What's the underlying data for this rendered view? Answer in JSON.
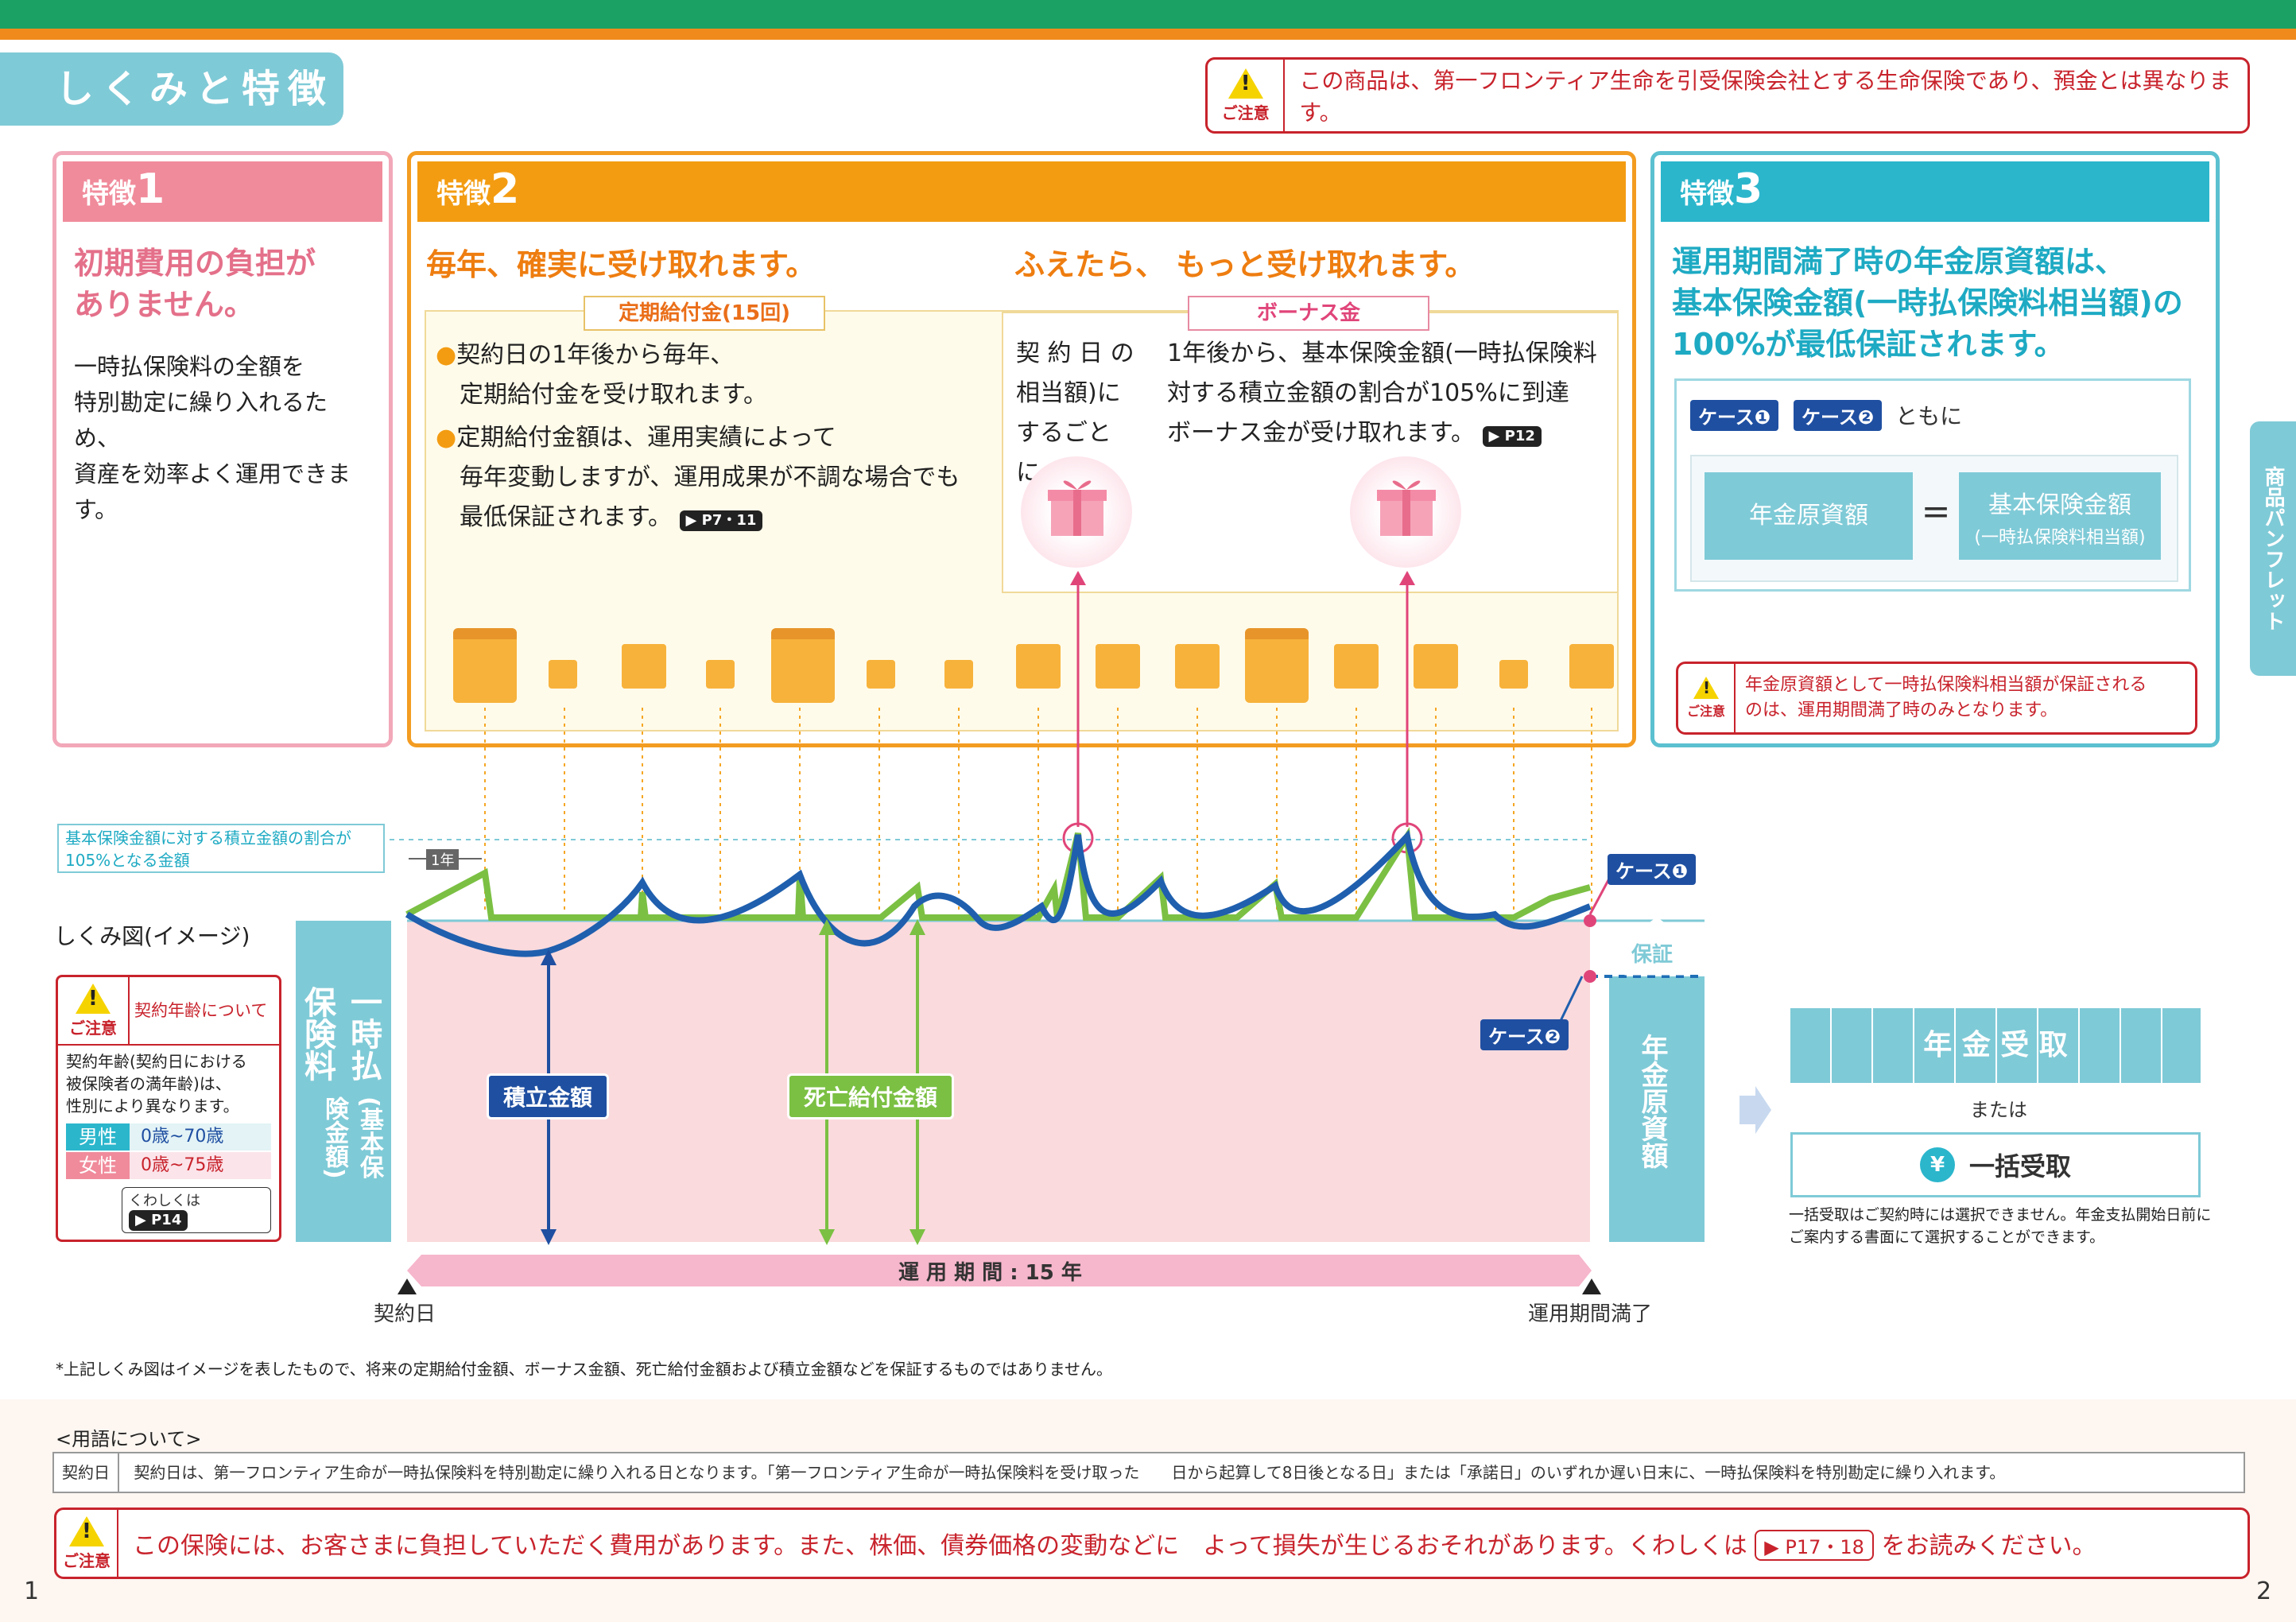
{
  "header": {
    "section_title": "しくみと特徴"
  },
  "caution_label": "ご注意",
  "top_notice": "この商品は、第一フロンティア生命を引受保険会社とする生命保険であり、預金とは異なります。",
  "side_tab": "商品パンフレット",
  "feature1": {
    "label": "特徴",
    "num": "1",
    "heading": [
      "初期費用の負担が",
      "ありません。"
    ],
    "body": [
      "一時払保険料の全額を",
      "特別勘定に繰り入れるため、",
      "資産を効率よく運用できます。"
    ]
  },
  "feature2": {
    "label": "特徴",
    "num": "2",
    "heading_left": "毎年、確実に受け取れます。",
    "heading_right": "ふえたら、 もっと受け取れます。",
    "left_tag": "定期給付金(15回)",
    "left_bullets": [
      [
        "契約日の1年後から毎年、",
        "定期給付金を受け取れます。"
      ],
      [
        "定期給付金額は、運用実績によって",
        "毎年変動しますが、運用成果が不調な場合でも",
        "最低保証されます。"
      ]
    ],
    "left_ref": "P7・11",
    "right_tag": "ボーナス金",
    "right_col1": [
      "契 約 日 の",
      "相当額)に",
      "するごとに、"
    ],
    "right_col2": [
      "1年後から、基本保険金額(一時払保険料",
      "対する積立金額の割合が105%に到達",
      "ボーナス金が受け取れます。"
    ],
    "right_ref": "P12"
  },
  "feature3": {
    "label": "特徴",
    "num": "3",
    "heading": [
      "運用期間満了時の年金原資額は、",
      "基本保険金額(一時払保険料相当額)の",
      "100%が最低保証されます。"
    ],
    "case1": "ケース❶",
    "case2": "ケース❷",
    "case_suffix": "ともに",
    "eq_left": "年金原資額",
    "eq_sign": "=",
    "eq_right_main": "基本保険金額",
    "eq_right_sub": "(一時払保険料相当額)",
    "caution_text": [
      "年金原資額として一時払保険料相当額が保証される",
      "のは、運用期間満了時のみとなります。"
    ]
  },
  "diagram": {
    "threshold_label": [
      "基本保険金額に対する積立金額の割合が",
      "105%となる金額"
    ],
    "one_year": "1年",
    "title": "しくみ図(イメージ)",
    "premium_label": "一時払保険料",
    "premium_sub": "(基本保険金額)",
    "reserve_label": "積立金額",
    "death_label": "死亡給付金額",
    "case1": "ケース❶",
    "case2": "ケース❷",
    "guarantee": "保証",
    "annuity_fund": "年金原資額",
    "period": "運 用 期 間 : 15 年",
    "start": "契約日",
    "end": "運用期間満了",
    "annuity_receive": "年 金 受 取",
    "or": "または",
    "lump_sum": "一括受取",
    "lump_note": [
      "一括受取はご契約時には選択できません。年金支払開始日前に",
      "ご案内する書面にて選択することができます。"
    ],
    "age_title": "契約年齢について",
    "age_body": [
      "契約年齢(契約日における",
      "被保険者の満年齢)は、",
      "性別により異なります。"
    ],
    "male": "男性",
    "male_range": "0歳~70歳",
    "female": "女性",
    "female_range": "0歳~75歳",
    "age_ref_label": "くわしくは",
    "age_ref": "P14"
  },
  "footnote": "*上記しくみ図はイメージを表したもので、将来の定期給付金額、ボーナス金額、死亡給付金額および積立金額などを保証するものではありません。",
  "terms": {
    "title": "<用語について>",
    "term": "契約日",
    "definition": "契約日は、第一フロンティア生命が一時払保険料を特別勘定に繰り入れる日となります。「第一フロンティア生命が一時払保険料を受け取った　　日から起算して8日後となる日」または「承諾日」のいずれか遅い日末に、一時払保険料を特別勘定に繰り入れます。"
  },
  "bottom_notice": "この保険には、お客さまに負担していただく費用があります。また、株価、債券価格の変動などに　よって損失が生じるおそれがあります。くわしくは",
  "bottom_ref": "P17・18",
  "bottom_suffix": "をお読みください。",
  "page_left": "1",
  "page_right": "2",
  "colors": {
    "green": "#1aa163",
    "orange": "#f08a1d",
    "pink": "#f08b9b",
    "teal": "#2bb6cc",
    "red": "#c8232c",
    "blue": "#1f4fa1"
  }
}
